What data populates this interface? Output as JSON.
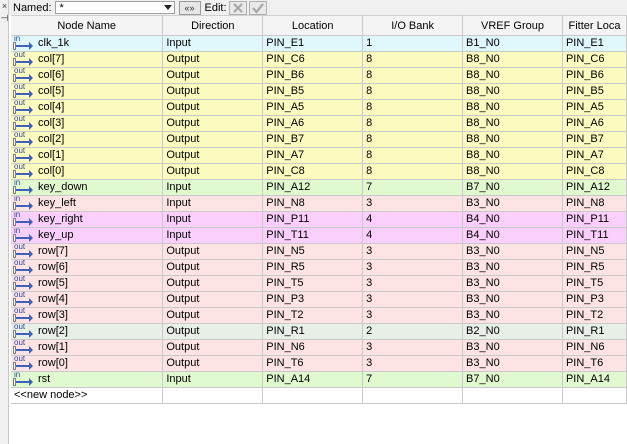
{
  "toolbar": {
    "named_label": "Named:",
    "named_value": "*",
    "expand_label": "«»",
    "edit_label": "Edit:"
  },
  "colors": {
    "input_blue": "#dff6fb",
    "output_yellow": "#fcfbbf",
    "key_green": "#e0f9cf",
    "key_pink": "#fde3e3",
    "key_magenta": "#fbcffb",
    "row_gray": "#e7efe6"
  },
  "table": {
    "columns": [
      "Node Name",
      "Direction",
      "Location",
      "I/O Bank",
      "VREF Group",
      "Fitter Loca"
    ],
    "rows": [
      {
        "icon": "in",
        "name": "clk_1k",
        "direction": "Input",
        "location": "PIN_E1",
        "bank": "1",
        "vref": "B1_N0",
        "fitter": "PIN_E1",
        "color": "#dff6fb"
      },
      {
        "icon": "out",
        "name": "col[7]",
        "direction": "Output",
        "location": "PIN_C6",
        "bank": "8",
        "vref": "B8_N0",
        "fitter": "PIN_C6",
        "color": "#fcfbbf"
      },
      {
        "icon": "out",
        "name": "col[6]",
        "direction": "Output",
        "location": "PIN_B6",
        "bank": "8",
        "vref": "B8_N0",
        "fitter": "PIN_B6",
        "color": "#fcfbbf"
      },
      {
        "icon": "out",
        "name": "col[5]",
        "direction": "Output",
        "location": "PIN_B5",
        "bank": "8",
        "vref": "B8_N0",
        "fitter": "PIN_B5",
        "color": "#fcfbbf"
      },
      {
        "icon": "out",
        "name": "col[4]",
        "direction": "Output",
        "location": "PIN_A5",
        "bank": "8",
        "vref": "B8_N0",
        "fitter": "PIN_A5",
        "color": "#fcfbbf"
      },
      {
        "icon": "out",
        "name": "col[3]",
        "direction": "Output",
        "location": "PIN_A6",
        "bank": "8",
        "vref": "B8_N0",
        "fitter": "PIN_A6",
        "color": "#fcfbbf"
      },
      {
        "icon": "out",
        "name": "col[2]",
        "direction": "Output",
        "location": "PIN_B7",
        "bank": "8",
        "vref": "B8_N0",
        "fitter": "PIN_B7",
        "color": "#fcfbbf"
      },
      {
        "icon": "out",
        "name": "col[1]",
        "direction": "Output",
        "location": "PIN_A7",
        "bank": "8",
        "vref": "B8_N0",
        "fitter": "PIN_A7",
        "color": "#fcfbbf"
      },
      {
        "icon": "out",
        "name": "col[0]",
        "direction": "Output",
        "location": "PIN_C8",
        "bank": "8",
        "vref": "B8_N0",
        "fitter": "PIN_C8",
        "color": "#fcfbbf"
      },
      {
        "icon": "in",
        "name": "key_down",
        "direction": "Input",
        "location": "PIN_A12",
        "bank": "7",
        "vref": "B7_N0",
        "fitter": "PIN_A12",
        "color": "#e0f9cf"
      },
      {
        "icon": "in",
        "name": "key_left",
        "direction": "Input",
        "location": "PIN_N8",
        "bank": "3",
        "vref": "B3_N0",
        "fitter": "PIN_N8",
        "color": "#fde3e3"
      },
      {
        "icon": "in",
        "name": "key_right",
        "direction": "Input",
        "location": "PIN_P11",
        "bank": "4",
        "vref": "B4_N0",
        "fitter": "PIN_P11",
        "color": "#fbcffb"
      },
      {
        "icon": "in",
        "name": "key_up",
        "direction": "Input",
        "location": "PIN_T11",
        "bank": "4",
        "vref": "B4_N0",
        "fitter": "PIN_T11",
        "color": "#fbcffb"
      },
      {
        "icon": "out",
        "name": "row[7]",
        "direction": "Output",
        "location": "PIN_N5",
        "bank": "3",
        "vref": "B3_N0",
        "fitter": "PIN_N5",
        "color": "#fde3e3"
      },
      {
        "icon": "out",
        "name": "row[6]",
        "direction": "Output",
        "location": "PIN_R5",
        "bank": "3",
        "vref": "B3_N0",
        "fitter": "PIN_R5",
        "color": "#fde3e3"
      },
      {
        "icon": "out",
        "name": "row[5]",
        "direction": "Output",
        "location": "PIN_T5",
        "bank": "3",
        "vref": "B3_N0",
        "fitter": "PIN_T5",
        "color": "#fde3e3"
      },
      {
        "icon": "out",
        "name": "row[4]",
        "direction": "Output",
        "location": "PIN_P3",
        "bank": "3",
        "vref": "B3_N0",
        "fitter": "PIN_P3",
        "color": "#fde3e3"
      },
      {
        "icon": "out",
        "name": "row[3]",
        "direction": "Output",
        "location": "PIN_T2",
        "bank": "3",
        "vref": "B3_N0",
        "fitter": "PIN_T2",
        "color": "#fde3e3"
      },
      {
        "icon": "out",
        "name": "row[2]",
        "direction": "Output",
        "location": "PIN_R1",
        "bank": "2",
        "vref": "B2_N0",
        "fitter": "PIN_R1",
        "color": "#e7efe6"
      },
      {
        "icon": "out",
        "name": "row[1]",
        "direction": "Output",
        "location": "PIN_N6",
        "bank": "3",
        "vref": "B3_N0",
        "fitter": "PIN_N6",
        "color": "#fde3e3"
      },
      {
        "icon": "out",
        "name": "row[0]",
        "direction": "Output",
        "location": "PIN_T6",
        "bank": "3",
        "vref": "B3_N0",
        "fitter": "PIN_T6",
        "color": "#fde3e3"
      },
      {
        "icon": "in",
        "name": "rst",
        "direction": "Input",
        "location": "PIN_A14",
        "bank": "7",
        "vref": "B7_N0",
        "fitter": "PIN_A14",
        "color": "#e0f9cf"
      }
    ],
    "new_node_label": "<<new node>>"
  }
}
